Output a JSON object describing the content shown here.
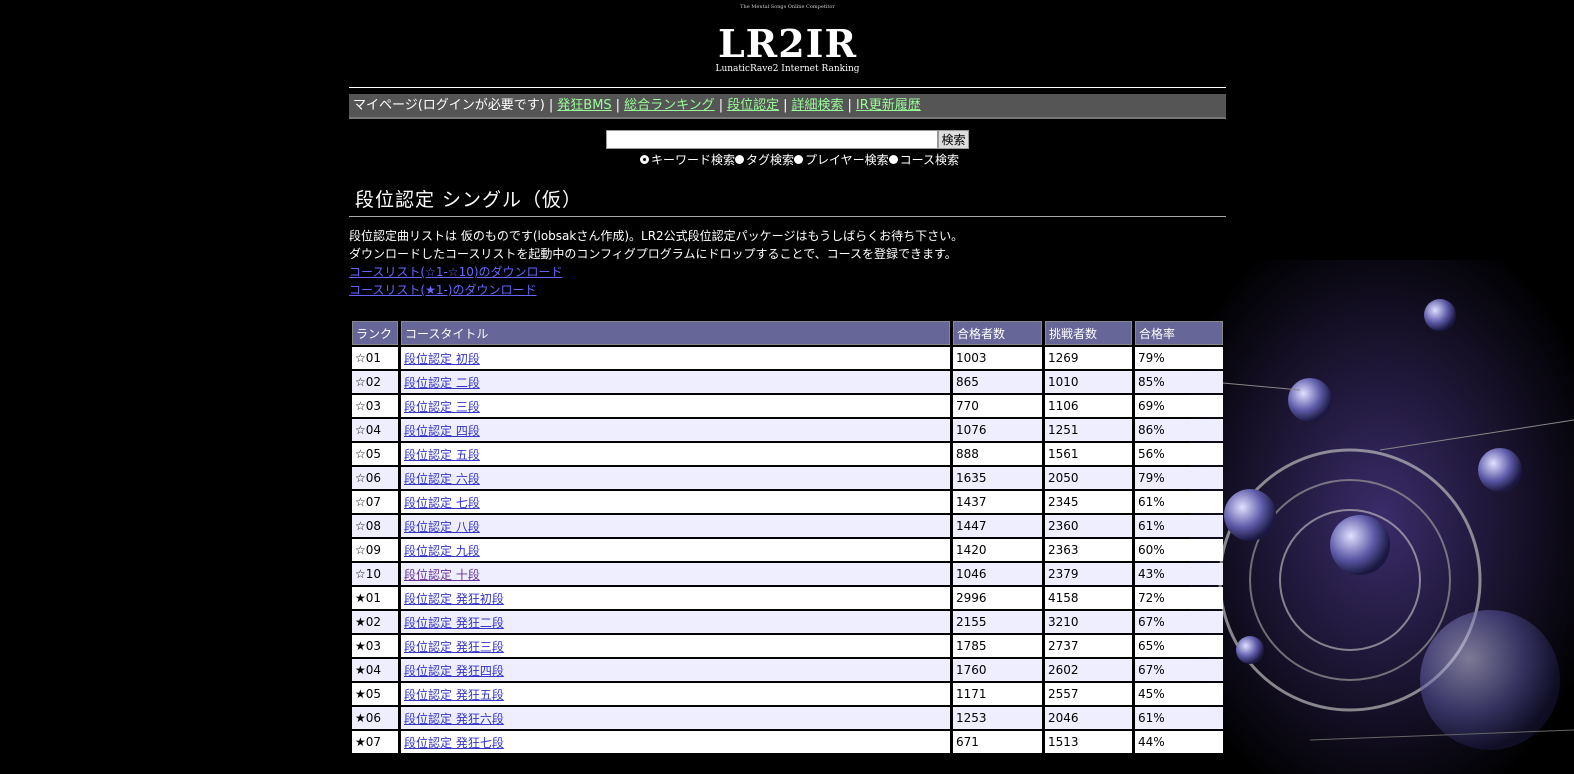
{
  "header": {
    "tiny_text": "The Mental Songs\nOnline Competitor",
    "logo_mark": "LR2IR",
    "logo_sub": "LunaticRave2 Internet Ranking"
  },
  "nav": {
    "mypage": "マイページ(ログインが必要です)",
    "items": [
      "発狂BMS",
      "総合ランキング",
      "段位認定",
      "詳細検索",
      "IR更新履歴"
    ]
  },
  "search": {
    "value": "",
    "button_label": "検索",
    "options": [
      "キーワード検索",
      "タグ検索",
      "プレイヤー検索",
      "コース検索"
    ],
    "selected": "キーワード検索"
  },
  "page_title": "段位認定 シングル（仮）",
  "description": {
    "line1": "段位認定曲リストは 仮のものです(lobsakさん作成)。LR2公式段位認定パッケージはもうしばらくお待ち下さい。",
    "line2": "ダウンロードしたコースリストを起動中のコンフィグプログラムにドロップすることで、コースを登録できます。",
    "link1": "コースリスト(☆1-☆10)のダウンロード",
    "link2": "コースリスト(★1-)のダウンロード"
  },
  "table": {
    "headers": [
      "ランク",
      "コースタイトル",
      "合格者数",
      "挑戦者数",
      "合格率"
    ],
    "rows": [
      {
        "rank": "☆01",
        "title": "段位認定 初段",
        "passed": "1003",
        "challengers": "1269",
        "rate": "79%"
      },
      {
        "rank": "☆02",
        "title": "段位認定 二段",
        "passed": "865",
        "challengers": "1010",
        "rate": "85%"
      },
      {
        "rank": "☆03",
        "title": "段位認定 三段",
        "passed": "770",
        "challengers": "1106",
        "rate": "69%"
      },
      {
        "rank": "☆04",
        "title": "段位認定 四段",
        "passed": "1076",
        "challengers": "1251",
        "rate": "86%"
      },
      {
        "rank": "☆05",
        "title": "段位認定 五段",
        "passed": "888",
        "challengers": "1561",
        "rate": "56%"
      },
      {
        "rank": "☆06",
        "title": "段位認定 六段",
        "passed": "1635",
        "challengers": "2050",
        "rate": "79%"
      },
      {
        "rank": "☆07",
        "title": "段位認定 七段",
        "passed": "1437",
        "challengers": "2345",
        "rate": "61%"
      },
      {
        "rank": "☆08",
        "title": "段位認定 八段",
        "passed": "1447",
        "challengers": "2360",
        "rate": "61%"
      },
      {
        "rank": "☆09",
        "title": "段位認定 九段",
        "passed": "1420",
        "challengers": "2363",
        "rate": "60%"
      },
      {
        "rank": "☆10",
        "title": "段位認定 十段",
        "passed": "1046",
        "challengers": "2379",
        "rate": "43%"
      },
      {
        "rank": "★01",
        "title": "段位認定 発狂初段",
        "passed": "2996",
        "challengers": "4158",
        "rate": "72%"
      },
      {
        "rank": "★02",
        "title": "段位認定 発狂二段",
        "passed": "2155",
        "challengers": "3210",
        "rate": "67%"
      },
      {
        "rank": "★03",
        "title": "段位認定 発狂三段",
        "passed": "1785",
        "challengers": "2737",
        "rate": "65%"
      },
      {
        "rank": "★04",
        "title": "段位認定 発狂四段",
        "passed": "1760",
        "challengers": "2602",
        "rate": "67%"
      },
      {
        "rank": "★05",
        "title": "段位認定 発狂五段",
        "passed": "1171",
        "challengers": "2557",
        "rate": "45%"
      },
      {
        "rank": "★06",
        "title": "段位認定 発狂六段",
        "passed": "1253",
        "challengers": "2046",
        "rate": "61%"
      },
      {
        "rank": "★07",
        "title": "段位認定 発狂七段",
        "passed": "671",
        "challengers": "1513",
        "rate": "44%"
      }
    ]
  },
  "colors": {
    "header_bg": "#666699",
    "nav_bg": "#555555",
    "nav_link": "#99ff99",
    "link": "#3333cc",
    "row_alt": "#eeeeff"
  }
}
